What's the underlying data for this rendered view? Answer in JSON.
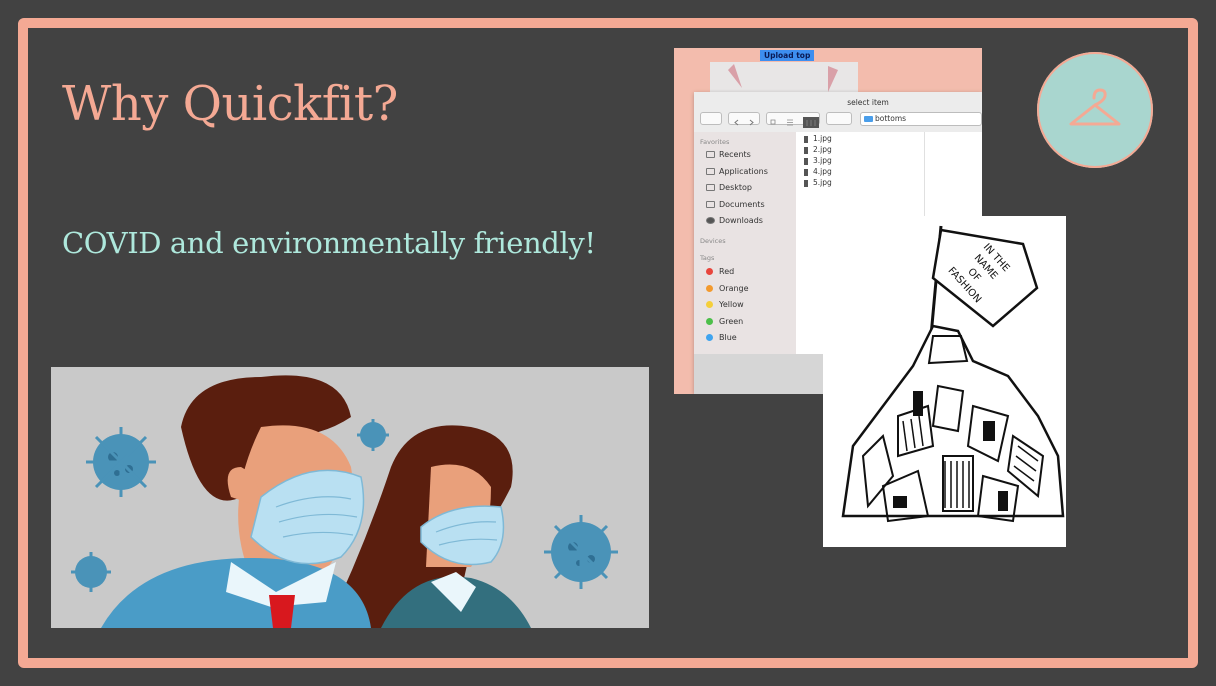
{
  "slide": {
    "title": "Why Quickfit?",
    "subtitle": "COVID and environmentally friendly!",
    "colors": {
      "background": "#424242",
      "accent": "#f4a994",
      "subtitle": "#aee8dc",
      "logo_bg": "#a9d6cf"
    },
    "logo_icon": "hanger-icon"
  },
  "finder": {
    "upload_button": "Upload top",
    "window_title": "select item",
    "folder": "bottoms",
    "favorites_header": "Favorites",
    "favorites": [
      "Recents",
      "Applications",
      "Desktop",
      "Documents",
      "Downloads"
    ],
    "devices_header": "Devices",
    "tags_header": "Tags",
    "tags": [
      {
        "label": "Red",
        "color": "#e8453c"
      },
      {
        "label": "Orange",
        "color": "#f39a2e"
      },
      {
        "label": "Yellow",
        "color": "#f5cf3a"
      },
      {
        "label": "Green",
        "color": "#4cbf4a"
      },
      {
        "label": "Blue",
        "color": "#3fa4ef"
      }
    ],
    "files": [
      "1.jpg",
      "2.jpg",
      "3.jpg",
      "4.jpg",
      "5.jpg"
    ]
  },
  "sketch": {
    "flag_text": [
      "IN THE",
      "NAME",
      "OF",
      "FASHION"
    ]
  }
}
